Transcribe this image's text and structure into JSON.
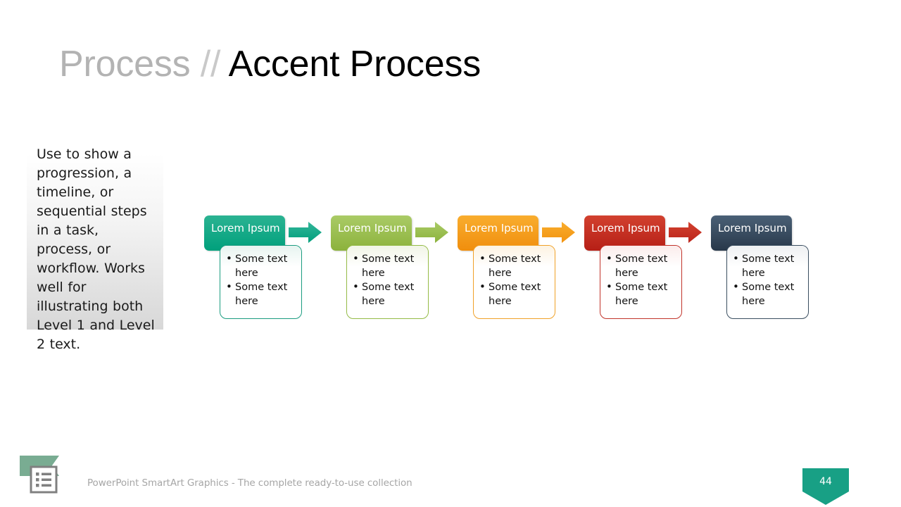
{
  "title": {
    "prefix": "Process",
    "separator": "//",
    "main": "Accent Process"
  },
  "description": {
    "text": "Use to show a progression, a timeline, or sequential steps in a task, process, or workflow. Works well for illustrating both Level 1 and Level 2 text."
  },
  "diagram": {
    "type": "accent-process",
    "steps": [
      {
        "header": "Lorem Ipsum",
        "bullets": [
          "Some text here",
          "Some text here"
        ],
        "color_top": "#2bb392",
        "color_bottom": "#00a07c",
        "border": "#1b9c80",
        "tint": "#e7f4f0",
        "arrow": true,
        "arrow_top": "#33b69a",
        "arrow_bottom": "#009e7c"
      },
      {
        "header": "Lorem Ipsum",
        "bullets": [
          "Some text here",
          "Some text here"
        ],
        "color_top": "#aacb66",
        "color_bottom": "#8cb23c",
        "border": "#94bb46",
        "tint": "#f1f5e6",
        "arrow": true,
        "arrow_top": "#aacb66",
        "arrow_bottom": "#8cb23c"
      },
      {
        "header": "Lorem Ipsum",
        "bullets": [
          "Some text here",
          "Some text here"
        ],
        "color_top": "#f9ad2e",
        "color_bottom": "#f08e0d",
        "border": "#f0a128",
        "tint": "#fdf3e2",
        "arrow": true,
        "arrow_top": "#f9ad2e",
        "arrow_bottom": "#f29310"
      },
      {
        "header": "Lorem Ipsum",
        "bullets": [
          "Some text here",
          "Some text here"
        ],
        "color_top": "#d2412f",
        "color_bottom": "#b61f16",
        "border": "#c1332a",
        "tint": "#fbeceb",
        "arrow": true,
        "arrow_top": "#d2412f",
        "arrow_bottom": "#bb241a"
      },
      {
        "header": "Lorem Ipsum",
        "bullets": [
          "Some text here",
          "Some text here"
        ],
        "color_top": "#4a6076",
        "color_bottom": "#28384a",
        "border": "#3a4e60",
        "tint": "#eef0f2",
        "arrow": false,
        "arrow_top": "#4a6076",
        "arrow_bottom": "#28384a"
      }
    ]
  },
  "footer": {
    "caption": "PowerPoint SmartArt Graphics - The complete ready-to-use collection",
    "logo_banner_color": "#79ac92",
    "logo_box_color": "#808080",
    "page_number": "44",
    "page_badge_color": "#18a085"
  }
}
